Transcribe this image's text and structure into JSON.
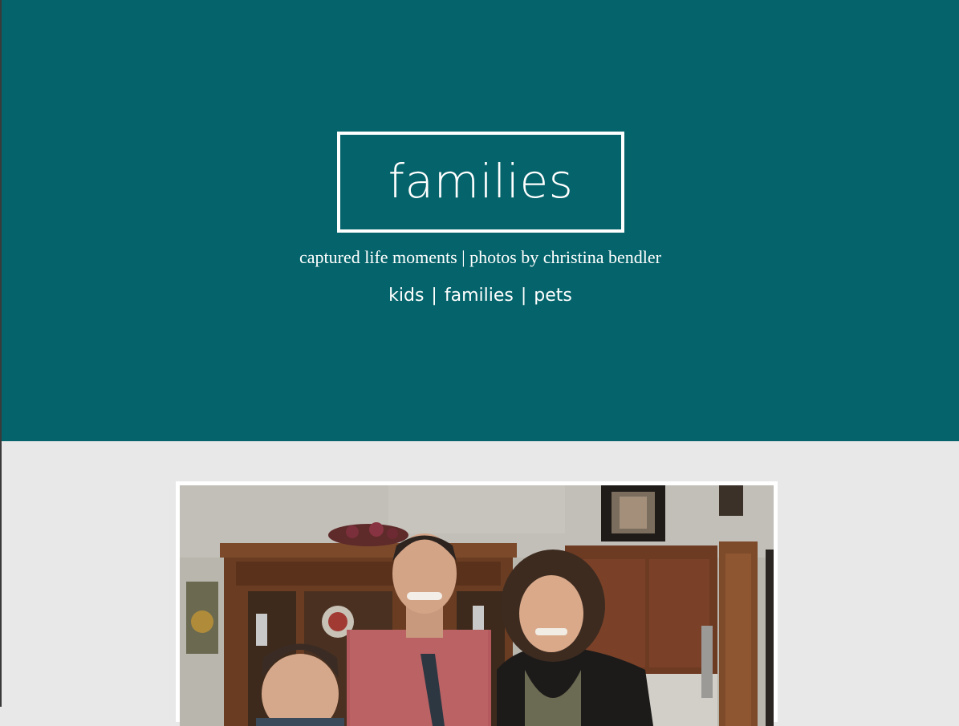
{
  "header": {
    "title": "families",
    "tagline": "captured life moments | photos by christina bendler"
  },
  "nav": {
    "items": [
      {
        "label": "kids"
      },
      {
        "label": "families"
      },
      {
        "label": "pets"
      }
    ],
    "separator": "|"
  },
  "colors": {
    "hero_background": "#05646b",
    "page_background": "#e8e8e8",
    "text": "#ffffff"
  },
  "photo": {
    "subject": "family portrait"
  }
}
